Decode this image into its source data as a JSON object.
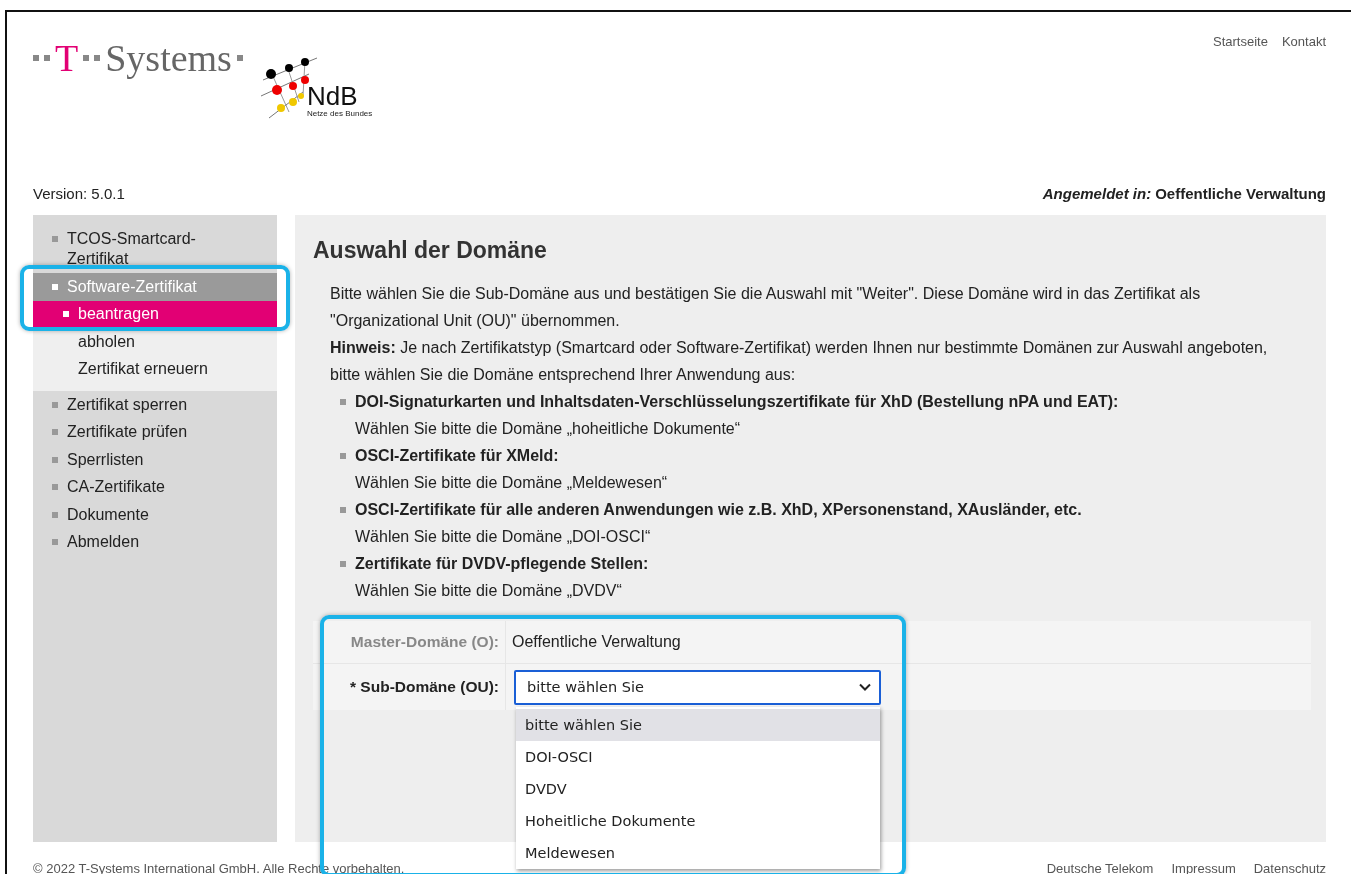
{
  "header": {
    "logo_mark": "T",
    "logo_name": "Systems",
    "partner_logo": {
      "name": "NdB",
      "tagline": "Netze des Bundes"
    },
    "links": [
      "Startseite",
      "Kontakt"
    ]
  },
  "info_bar": {
    "version": "Version: 5.0.1",
    "login_label": "Angemeldet in:",
    "login_value": "Oeffentliche Verwaltung"
  },
  "sidebar": {
    "items": [
      {
        "label": "TCOS-Smartcard-Zertifikat",
        "selected": false,
        "highlighted": false
      },
      {
        "label": "Software-Zertifikat",
        "selected": true,
        "highlighted": true,
        "children": [
          {
            "label": "beantragen",
            "selected": true
          },
          {
            "label": "abholen",
            "selected": false
          },
          {
            "label": "Zertifikat erneuern",
            "selected": false
          }
        ]
      },
      {
        "label": "Zertifikat sperren",
        "selected": false,
        "highlighted": false
      },
      {
        "label": "Zertifikate prüfen",
        "selected": false,
        "highlighted": false
      },
      {
        "label": "Sperrlisten",
        "selected": false,
        "highlighted": false
      },
      {
        "label": "CA-Zertifikate",
        "selected": false,
        "highlighted": false
      },
      {
        "label": "Dokumente",
        "selected": false,
        "highlighted": false
      },
      {
        "label": "Abmelden",
        "selected": false,
        "highlighted": false
      }
    ]
  },
  "content": {
    "title": "Auswahl der Domäne",
    "intro": "Bitte wählen Sie die Sub-Domäne aus und bestätigen Sie die Auswahl mit \"Weiter\". Diese Domäne wird in das Zertifikat als \"Organizational Unit (OU)\" übernommen.",
    "note": "**Hinweis:** Je nach Zertifikatstyp (Smartcard oder Software-Zertifikat) werden Ihnen nur bestimmte Domänen zur Auswahl angeboten, bitte wählen Sie die Domäne entsprechend Ihrer Anwendung aus:",
    "bullets": [
      {
        "title": "DOI-Signaturkarten und Inhaltsdaten-Verschlüsselungszertifikate für XhD (Bestellung nPA und EAT):",
        "text": "Wählen Sie bitte die Domäne „hoheitliche Dokumente“"
      },
      {
        "title": "OSCI-Zertifikate für XMeld:",
        "text": "Wählen Sie bitte die Domäne „Meldewesen“"
      },
      {
        "title": "OSCI-Zertifikate für alle anderen Anwendungen wie z.B. XhD, XPersonenstand, XAusländer, etc.",
        "text": "Wählen Sie bitte die Domäne „DOI-OSCI“"
      },
      {
        "title": "Zertifikate für DVDV-pflegende Stellen:",
        "text": "Wählen Sie bitte die Domäne „DVDV“"
      }
    ],
    "form": {
      "highlighted": true,
      "rows": [
        {
          "kind": "text",
          "label": "Master-Domäne (O):",
          "value": "Oeffentliche Verwaltung"
        },
        {
          "kind": "select",
          "label": "* Sub-Domäne (OU):",
          "value": "bitte wählen Sie",
          "expanded": true,
          "options": [
            {
              "label": "bitte wählen Sie",
              "selected": true
            },
            {
              "label": "DOI-OSCI",
              "selected": false
            },
            {
              "label": "DVDV",
              "selected": false
            },
            {
              "label": "Hoheitliche Dokumente",
              "selected": false
            },
            {
              "label": "Meldewesen",
              "selected": false
            }
          ]
        }
      ]
    }
  },
  "footer": {
    "copyright": "© 2022 T-Systems International GmbH. Alle Rechte vorbehalten.",
    "links": [
      "Deutsche Telekom",
      "Impressum",
      "Datenschutz"
    ]
  }
}
